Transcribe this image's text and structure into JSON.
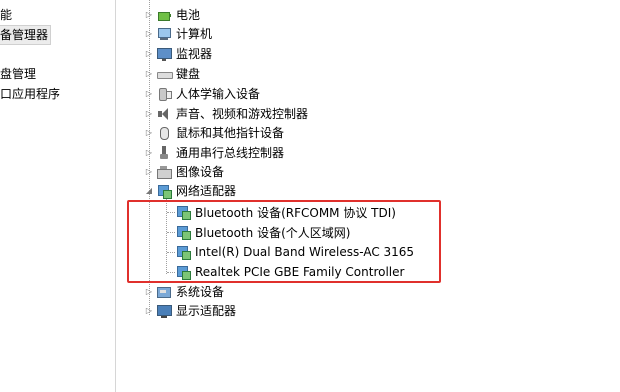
{
  "left_pane": {
    "items": [
      {
        "label": "能"
      },
      {
        "label": "备管理器",
        "selected": true
      },
      {
        "label": "盘管理"
      },
      {
        "label": "口应用程序"
      }
    ]
  },
  "tree": {
    "categories": [
      {
        "label": "电池",
        "icon": "battery-icon"
      },
      {
        "label": "计算机",
        "icon": "computer-icon"
      },
      {
        "label": "监视器",
        "icon": "monitor-icon"
      },
      {
        "label": "键盘",
        "icon": "keyboard-icon"
      },
      {
        "label": "人体学输入设备",
        "icon": "hid-icon"
      },
      {
        "label": "声音、视频和游戏控制器",
        "icon": "sound-icon"
      },
      {
        "label": "鼠标和其他指针设备",
        "icon": "mouse-icon"
      },
      {
        "label": "通用串行总线控制器",
        "icon": "usb-icon"
      },
      {
        "label": "图像设备",
        "icon": "imaging-icon"
      },
      {
        "label": "网络适配器",
        "icon": "network-adapter-icon",
        "expanded": true
      },
      {
        "label": "系统设备",
        "icon": "system-device-icon"
      },
      {
        "label": "显示适配器",
        "icon": "display-adapter-icon"
      }
    ],
    "network_adapters": [
      {
        "label": "Bluetooth 设备(RFCOMM 协议 TDI)"
      },
      {
        "label": "Bluetooth 设备(个人区域网)"
      },
      {
        "label": "Intel(R) Dual Band Wireless-AC 3165"
      },
      {
        "label": "Realtek PCIe GBE Family Controller"
      }
    ]
  },
  "colors": {
    "highlight_box": "#e0302c",
    "selected_bg": "#ececec"
  }
}
